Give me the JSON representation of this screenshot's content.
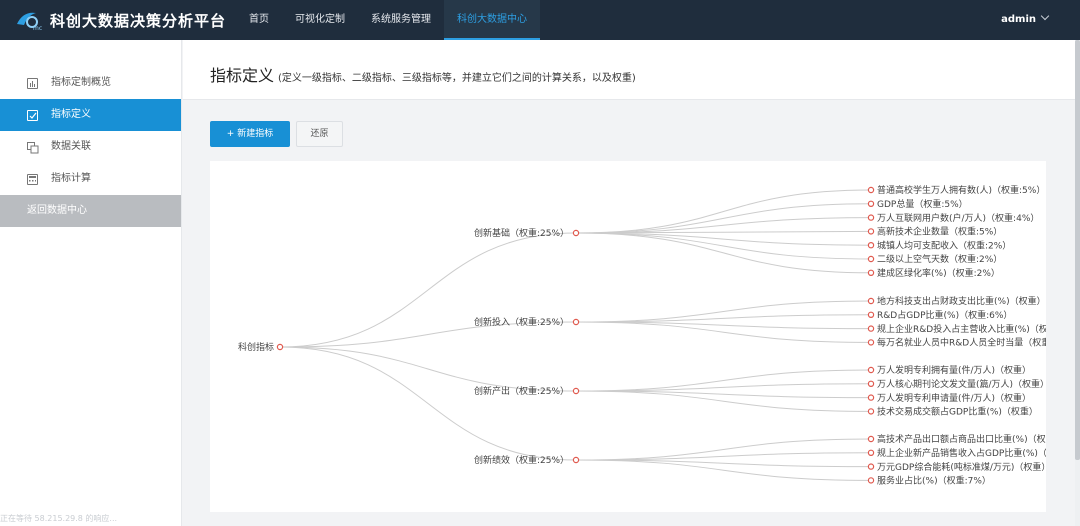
{
  "app": {
    "title": "科创大数据决策分析平台"
  },
  "nav": [
    {
      "label": "首页",
      "active": false
    },
    {
      "label": "可视化定制",
      "active": false
    },
    {
      "label": "系统服务管理",
      "active": false
    },
    {
      "label": "科创大数据中心",
      "active": true
    }
  ],
  "user": {
    "name": "admin"
  },
  "sidebar": {
    "items": [
      {
        "label": "指标定制概览",
        "icon": "bar-chart-icon",
        "active": false
      },
      {
        "label": "指标定义",
        "icon": "checkbox-icon",
        "active": true
      },
      {
        "label": "数据关联",
        "icon": "link-copy-icon",
        "active": false
      },
      {
        "label": "指标计算",
        "icon": "calculator-icon",
        "active": false
      }
    ],
    "back_label": "返回数据中心"
  },
  "page": {
    "title": "指标定义",
    "subtitle": "(定义一级指标、二级指标、三级指标等，并建立它们之间的计算关系，以及权重)"
  },
  "toolbar": {
    "new_label": "+ 新建指标",
    "reset_label": "还原"
  },
  "status_text": "正在等待 58.215.29.8 的响应...",
  "colors": {
    "accent": "#1890d5",
    "topbar": "#1f2d3d",
    "node": "#e05a4f",
    "link": "#cccccc"
  },
  "tree": {
    "root": "科创指标",
    "branches": [
      {
        "label": "创新基础（权重:25%）",
        "children": [
          "普通高校学生万人拥有数(人)（权重:5%）",
          "GDP总量（权重:5%）",
          "万人互联网用户数(户/万人)（权重:4%）",
          "高新技术企业数量（权重:5%）",
          "城镇人均可支配收入（权重:2%）",
          "二级以上空气天数（权重:2%）",
          "建成区绿化率(%)（权重:2%）"
        ]
      },
      {
        "label": "创新投入（权重:25%）",
        "children": [
          "地方科技支出占财政支出比重(%)（权重）",
          "R&D占GDP比重(%)（权重:6%）",
          "规上企业R&D投入占主营收入比重(%)（权重）",
          "每万名就业人员中R&D人员全时当量（权重）"
        ]
      },
      {
        "label": "创新产出（权重:25%）",
        "children": [
          "万人发明专利拥有量(件/万人)（权重）",
          "万人核心期刊论文发文量(篇/万人)（权重）",
          "万人发明专利申请量(件/万人)（权重）",
          "技术交易成交额占GDP比重(%)（权重）"
        ]
      },
      {
        "label": "创新绩效（权重:25%）",
        "children": [
          "高技术产品出口额占商品出口比重(%)（权重）",
          "规上企业新产品销售收入占GDP比重(%)（权重）",
          "万元GDP综合能耗(吨标准煤/万元)（权重）",
          "服务业占比(%)（权重:7%）"
        ]
      }
    ]
  }
}
